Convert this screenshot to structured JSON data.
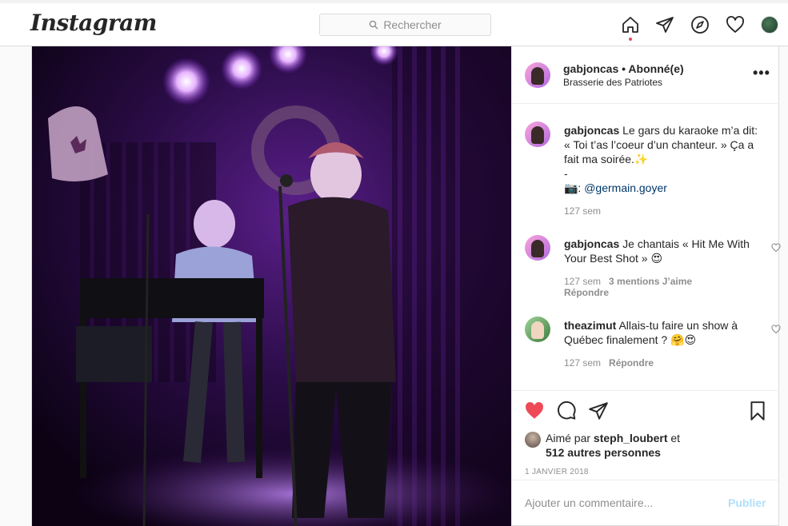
{
  "nav": {
    "logo": "Instagram",
    "search_placeholder": "Rechercher",
    "icons": [
      "home-icon",
      "direct-icon",
      "explore-icon",
      "activity-icon",
      "profile-avatar"
    ],
    "active_dot_color": "#ed4956"
  },
  "post": {
    "username": "gabjoncas",
    "follow_status": "Abonné(e)",
    "location": "Brasserie des Patriotes",
    "caption": {
      "user": "gabjoncas",
      "line1": "Le gars du karaoke m’a dit: « Toi t’as l’coeur d’un chanteur. » Ça a fait ma soirée.✨",
      "dash": "-",
      "credit_prefix": "📷: ",
      "credit_mention": "@germain.goyer",
      "age": "127 sem"
    },
    "comments": [
      {
        "user": "gabjoncas",
        "text": "Je chantais « Hit Me With Your Best Shot » 😍",
        "age": "127 sem",
        "likes": "3 mentions J’aime",
        "reply": "Répondre"
      },
      {
        "user": "theazimut",
        "text": "Allais-tu faire un show à Québec finalement ? 🤗😍",
        "age": "127 sem",
        "reply": "Répondre"
      }
    ],
    "liked_by": {
      "prefix": "Aimé par",
      "user": "steph_loubert",
      "joiner": "et",
      "others": "512 autres personnes"
    },
    "date": "1 JANVIER 2018",
    "add_comment_placeholder": "Ajouter un commentaire...",
    "publish_label": "Publier",
    "like_color": "#ed4956"
  }
}
